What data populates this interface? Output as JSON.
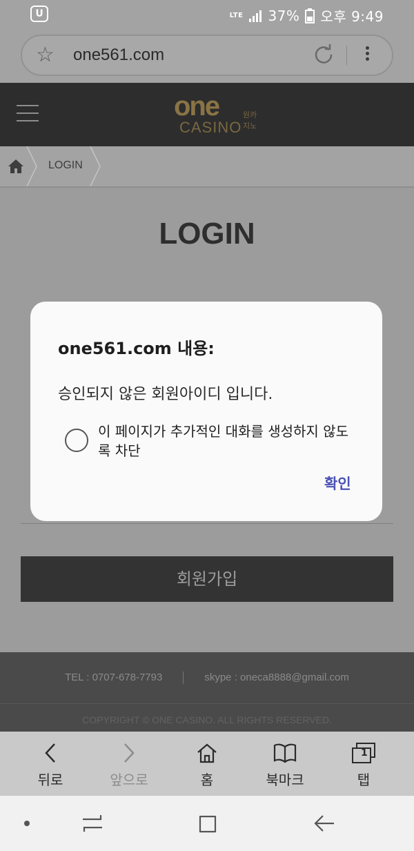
{
  "status_bar": {
    "network": "LTE",
    "battery": "37%",
    "time": "오후 9:49"
  },
  "browser": {
    "url": "one561.com"
  },
  "site": {
    "logo_text": "one",
    "logo_sub": "원카지노",
    "logo_casino": "CASINO",
    "breadcrumb_label": "LOGIN",
    "page_title": "LOGIN",
    "signup_label": "회원가입",
    "footer": {
      "tel": "TEL : 0707-678-7793",
      "skype": "skype : oneca8888@gmail.com",
      "copyright": "COPYRIGHT © ONE CASINO. ALL RIGHTS RESERVED."
    }
  },
  "dialog": {
    "title": "one561.com 내용:",
    "message": "승인되지 않은 회원아이디 입니다.",
    "checkbox_label": "이 페이지가 추가적인 대화를 생성하지 않도록 차단",
    "ok_label": "확인"
  },
  "toolbar": {
    "back": "뒤로",
    "forward": "앞으로",
    "home": "홈",
    "bookmarks": "북마크",
    "tabs": "탭",
    "tab_count": "1"
  },
  "colors": {
    "dialog_button": "#4b52b6",
    "header_bg": "#2d2d2d",
    "logo_gold": "#8a7445"
  }
}
